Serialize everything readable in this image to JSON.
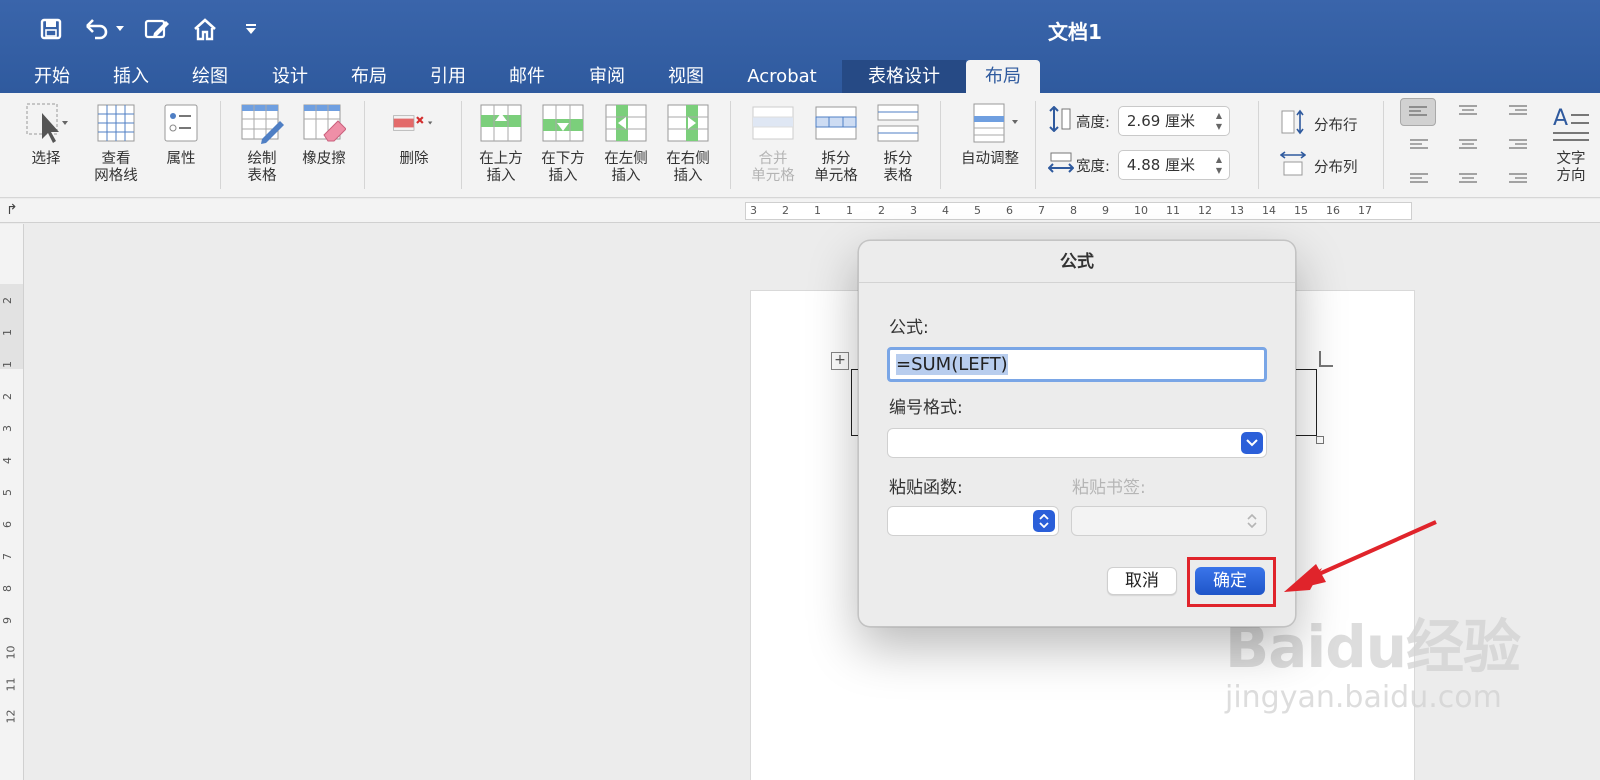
{
  "window": {
    "title": "文档1"
  },
  "quick_access": [
    "save-icon",
    "undo-icon",
    "edit-icon",
    "home-icon",
    "customize-icon"
  ],
  "tabs": [
    {
      "label": "开始"
    },
    {
      "label": "插入"
    },
    {
      "label": "绘图"
    },
    {
      "label": "设计"
    },
    {
      "label": "布局"
    },
    {
      "label": "引用"
    },
    {
      "label": "邮件"
    },
    {
      "label": "审阅"
    },
    {
      "label": "视图"
    },
    {
      "label": "Acrobat"
    },
    {
      "label": "表格设计"
    },
    {
      "label": "布局"
    }
  ],
  "active_tab_index": 11,
  "ribbon": {
    "select": "选择",
    "gridlines": "查看\n网格线",
    "properties": "属性",
    "draw_table": "绘制\n表格",
    "eraser": "橡皮擦",
    "delete": "删除",
    "insert_above": "在上方\n插入",
    "insert_below": "在下方\n插入",
    "insert_left": "在左侧\n插入",
    "insert_right": "在右侧\n插入",
    "merge_cells": "合并\n单元格",
    "split_cells": "拆分\n单元格",
    "split_table": "拆分\n表格",
    "autofit": "自动调整",
    "height_label": "高度:",
    "height_value": "2.69 厘米",
    "width_label": "宽度:",
    "width_value": "4.88 厘米",
    "distribute_rows": "分布行",
    "distribute_cols": "分布列",
    "text_direction": "文字\n方向"
  },
  "ruler": {
    "numbers": [
      "3",
      "2",
      "1",
      "1",
      "2",
      "3",
      "4",
      "5",
      "6",
      "7",
      "8",
      "9",
      "10",
      "11",
      "12",
      "13",
      "14",
      "15",
      "16",
      "17"
    ],
    "vertical_numbers": [
      "2",
      "1",
      "1",
      "2",
      "3",
      "4",
      "5",
      "6",
      "7",
      "8",
      "9",
      "10",
      "11",
      "12"
    ]
  },
  "dialog": {
    "title": "公式",
    "formula_label": "公式:",
    "formula_value": "=SUM(LEFT)",
    "number_format_label": "编号格式:",
    "number_format_value": "",
    "paste_function_label": "粘贴函数:",
    "paste_bookmark_label": "粘贴书签:",
    "cancel": "取消",
    "ok": "确定"
  },
  "colors": {
    "title_bar": "#2f5a9e",
    "accent_button": "#2b5fd9",
    "highlight": "#e0242b"
  },
  "watermark": {
    "logo": "Baidu经验",
    "url": "jingyan.baidu.com"
  }
}
